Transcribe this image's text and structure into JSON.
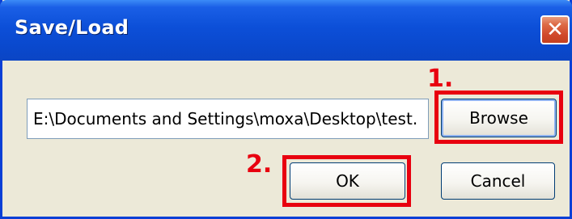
{
  "window": {
    "title": "Save/Load",
    "close_glyph": "✕"
  },
  "form": {
    "path_value": "E:\\Documents and Settings\\moxa\\Desktop\\test.",
    "browse_label": "Browse",
    "ok_label": "OK",
    "cancel_label": "Cancel"
  },
  "annotations": {
    "step1": "1.",
    "step2": "2.",
    "highlight_color": "#e8000f"
  },
  "theme": {
    "titlebar_color": "#0c4fd8",
    "dialog_bg": "#ece9d8",
    "close_color": "#d0482a"
  }
}
